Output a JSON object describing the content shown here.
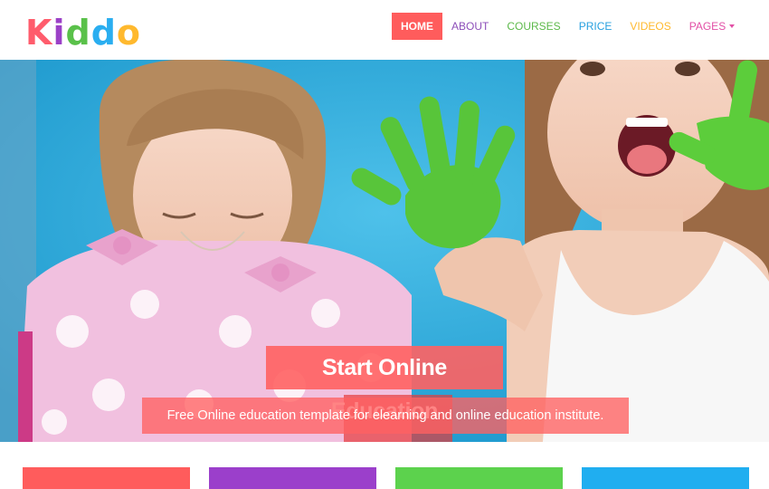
{
  "brand": {
    "letters": [
      "K",
      "i",
      "d",
      "d",
      "o"
    ],
    "colors": [
      "#ff5c6c",
      "#9b41c7",
      "#5ac14a",
      "#2aaef0",
      "#ffb92e"
    ]
  },
  "nav": {
    "items": [
      {
        "label": "Home",
        "color": "#ff5c5c",
        "active": true
      },
      {
        "label": "About",
        "color": "#8d4fb9",
        "active": false
      },
      {
        "label": "Courses",
        "color": "#5cb94a",
        "active": false
      },
      {
        "label": "Price",
        "color": "#27a0df",
        "active": false
      },
      {
        "label": "Videos",
        "color": "#ffb92e",
        "active": false
      },
      {
        "label": "Pages",
        "color": "#e24fa6",
        "active": false,
        "dropdown": true
      }
    ]
  },
  "hero": {
    "title": "Start Online Education",
    "subtitle": "Free Online education template for elearning and online education institute."
  },
  "cards": {
    "colors": [
      "#ff5c5c",
      "#9b3fcb",
      "#5cd24d",
      "#20aef0"
    ]
  }
}
